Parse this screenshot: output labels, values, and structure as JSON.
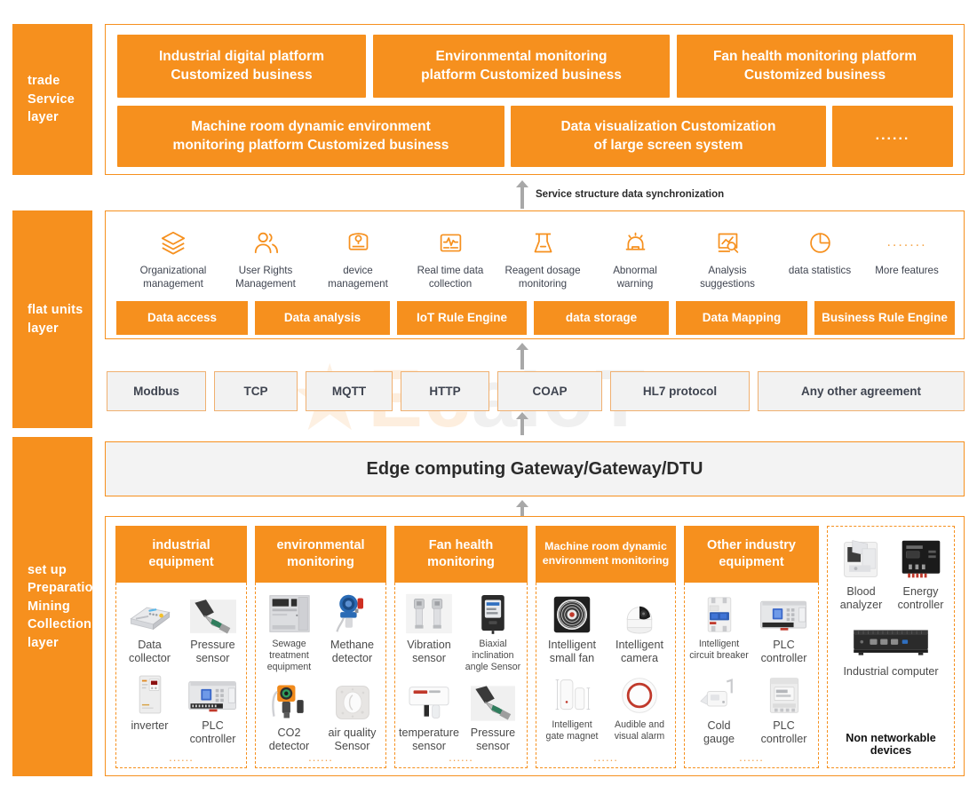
{
  "theme": {
    "orange": "#f6901e",
    "grey_card": "#f2f2f2",
    "arrow_grey": "#a8a8a8",
    "text_dark": "#3f4450"
  },
  "watermark": {
    "text": "EcaIoT"
  },
  "layers": [
    {
      "id": "trade",
      "label": "trade\nService\nlayer"
    },
    {
      "id": "flat",
      "label": "flat units\nlayer"
    },
    {
      "id": "setup",
      "label": "set up\nPreparation\nMining\nCollection\nlayer"
    }
  ],
  "service_layer": {
    "row1": [
      {
        "label": "Industrial digital platform\nCustomized business"
      },
      {
        "label": "Environmental monitoring\nplatform  Customized business"
      },
      {
        "label": "Fan health monitoring platform\nCustomized business"
      }
    ],
    "row2": [
      {
        "label": "Machine room dynamic environment\nmonitoring platform Customized business"
      },
      {
        "label": "Data visualization Customization\nof large screen system"
      },
      {
        "label": "......"
      }
    ]
  },
  "sync_note": {
    "label": "Service structure data synchronization"
  },
  "flat_layer": {
    "features": [
      {
        "icon": "layers-icon",
        "label": "Organizational\nmanagement"
      },
      {
        "icon": "users-icon",
        "label": "User Rights\nManagement"
      },
      {
        "icon": "device-box-icon",
        "label": "device\nmanagement"
      },
      {
        "icon": "monitor-wave-icon",
        "label": "Real time data\ncollection"
      },
      {
        "icon": "flask-icon",
        "label": "Reagent dosage\nmonitoring"
      },
      {
        "icon": "alarm-bell-icon",
        "label": "Abnormal\nwarning"
      },
      {
        "icon": "chart-search-icon",
        "label": "Analysis\nsuggestions"
      },
      {
        "icon": "pie-chart-icon",
        "label": "data statistics"
      },
      {
        "icon": "ellipsis-icon",
        "label": "More features"
      }
    ],
    "capabilities": [
      {
        "label": "Data access"
      },
      {
        "label": "Data analysis"
      },
      {
        "label": "IoT Rule Engine"
      },
      {
        "label": "data storage"
      },
      {
        "label": "Data Mapping"
      },
      {
        "label": "Business Rule Engine"
      }
    ]
  },
  "protocols": [
    {
      "label": "Modbus"
    },
    {
      "label": "TCP"
    },
    {
      "label": "MQTT"
    },
    {
      "label": "HTTP"
    },
    {
      "label": "COAP"
    },
    {
      "label": "HL7 protocol"
    },
    {
      "label": "Any other agreement"
    }
  ],
  "gateway": {
    "label": "Edge computing Gateway/Gateway/DTU"
  },
  "device_columns": [
    {
      "title": "industrial\nequipment",
      "items": [
        {
          "pic": "data-collector-photo",
          "label": "Data\ncollector"
        },
        {
          "pic": "pressure-sensor-photo",
          "label": "Pressure\nsensor"
        },
        {
          "pic": "inverter-photo",
          "label": "inverter"
        },
        {
          "pic": "plc-controller-photo",
          "label": "PLC\ncontroller"
        }
      ],
      "more": "......"
    },
    {
      "title": "environmental\nmonitoring",
      "items": [
        {
          "pic": "sewage-treatment-photo",
          "label": "Sewage treatment\nequipment",
          "small": true
        },
        {
          "pic": "methane-detector-photo",
          "label": "Methane\ndetector"
        },
        {
          "pic": "co2-detector-photo",
          "label": "CO2\ndetector"
        },
        {
          "pic": "air-quality-sensor-photo",
          "label": "air quality\nSensor"
        }
      ],
      "more": "......"
    },
    {
      "title": "Fan health\nmonitoring",
      "items": [
        {
          "pic": "vibration-sensor-photo",
          "label": "Vibration\nsensor"
        },
        {
          "pic": "biaxial-inclination-photo",
          "label": "Biaxial\ninclination\nangle Sensor",
          "small": true
        },
        {
          "pic": "temperature-sensor-photo",
          "label": "temperature\nsensor"
        },
        {
          "pic": "pressure-sensor-photo",
          "label": "Pressure\nsensor"
        }
      ],
      "more": "......"
    },
    {
      "title": "Machine room dynamic\nenvironment monitoring",
      "small_title": true,
      "items": [
        {
          "pic": "small-fan-photo",
          "label": "Intelligent\nsmall fan"
        },
        {
          "pic": "camera-photo",
          "label": "Intelligent\ncamera"
        },
        {
          "pic": "gate-magnet-photo",
          "label": "Intelligent\ngate magnet",
          "small": true
        },
        {
          "pic": "audible-visual-alarm-photo",
          "label": "Audible and\nvisual alarm",
          "small": true
        }
      ],
      "more": "......"
    },
    {
      "title": "Other industry\nequipment",
      "items": [
        {
          "pic": "circuit-breaker-photo",
          "label": "Intelligent\ncircuit breaker",
          "small": true
        },
        {
          "pic": "plc-controller-photo",
          "label": "PLC\ncontroller"
        },
        {
          "pic": "cold-gauge-photo",
          "label": "Cold\ngauge"
        },
        {
          "pic": "plc-controller2-photo",
          "label": "PLC\ncontroller"
        }
      ],
      "more": "......"
    }
  ],
  "non_networkable": {
    "items": [
      {
        "pic": "blood-analyzer-photo",
        "label": "Blood\nanalyzer"
      },
      {
        "pic": "energy-controller-photo",
        "label": "Energy\ncontroller"
      }
    ],
    "wide": {
      "pic": "industrial-computer-photo",
      "label": "Industrial computer"
    },
    "note": "Non networkable devices"
  }
}
